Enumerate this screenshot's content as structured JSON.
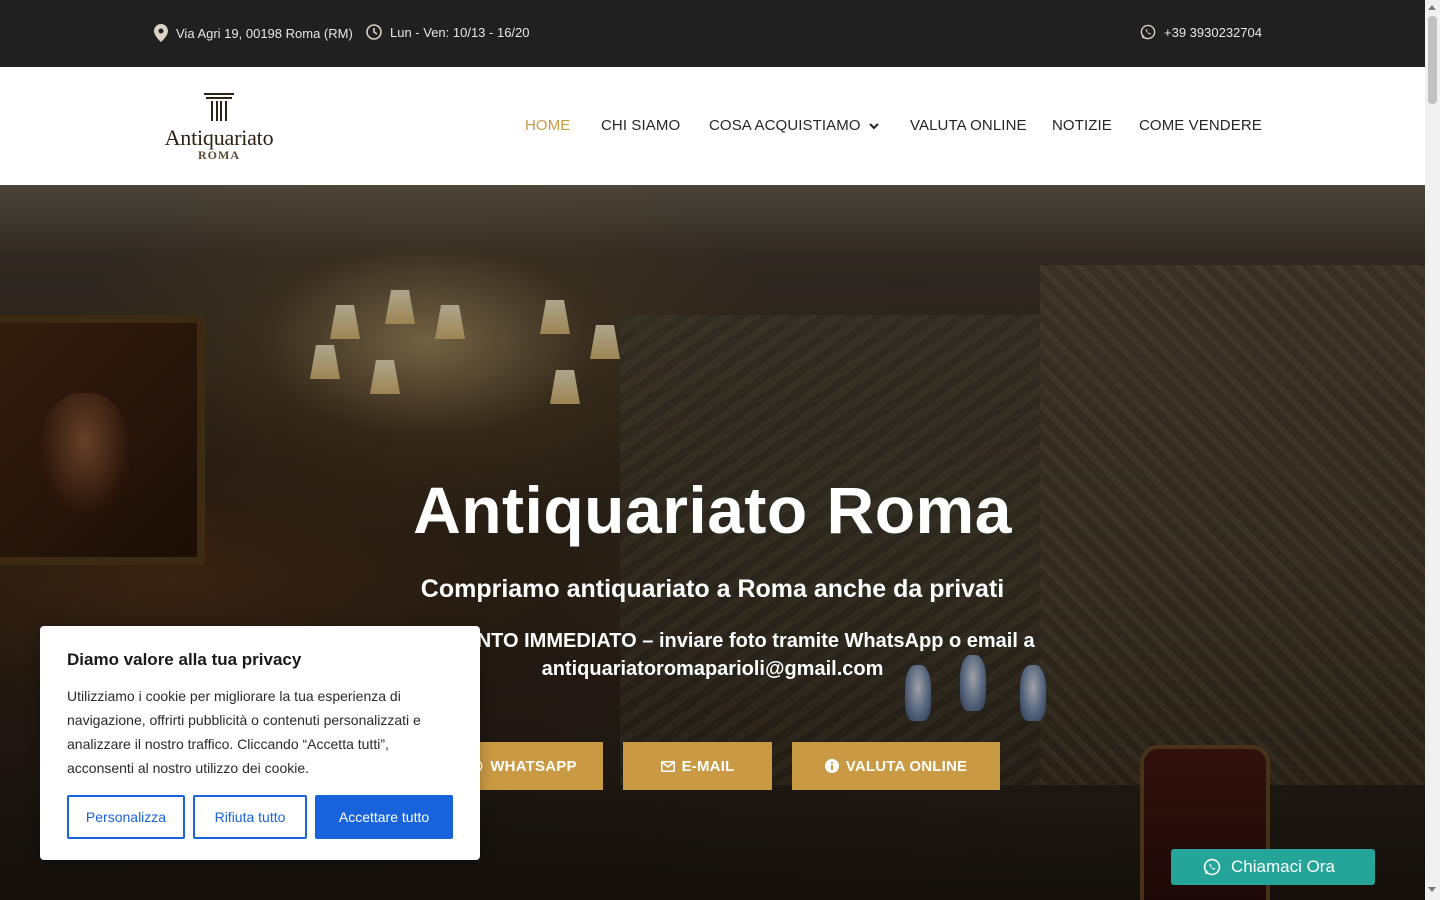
{
  "topbar": {
    "address": "Via Agri 19, 00198 Roma (RM)",
    "hours": "Lun - Ven: 10/13 - 16/20",
    "phone": "+39 3930232704"
  },
  "logo": {
    "name": "Antiquariato",
    "sub": "ROMA"
  },
  "nav": {
    "items": [
      {
        "label": "HOME",
        "active": true
      },
      {
        "label": "CHI SIAMO"
      },
      {
        "label": "COSA ACQUISTIAMO",
        "has_dropdown": true
      },
      {
        "label": "VALUTA ONLINE"
      },
      {
        "label": "NOTIZIE"
      },
      {
        "label": "COME VENDERE"
      }
    ]
  },
  "hero": {
    "title": "Antiquariato Roma",
    "subtitle": "Compriamo antiquariato a Roma anche da privati",
    "lead_line1": "PAGAMENTO IMMEDIATO – inviare foto tramite WhatsApp o email a",
    "lead_line2": "antiquariatoromaparioli@gmail.com",
    "buttons": {
      "whatsapp": "WHATSAPP",
      "email": "E-MAIL",
      "valuta": "VALUTA ONLINE"
    }
  },
  "cookie": {
    "title": "Diamo valore alla tua privacy",
    "text": "Utilizziamo i cookie per migliorare la tua esperienza di navigazione, offrirti pubblicità o contenuti personalizzati e analizzare il nostro traffico. Cliccando “Accetta tutti”, acconsenti al nostro utilizzo dei cookie.",
    "customize": "Personalizza",
    "reject": "Rifiuta tutto",
    "accept": "Accettare tutto"
  },
  "floating": {
    "call": "Chiamaci Ora"
  },
  "colors": {
    "accent": "#c99a43",
    "nav_active": "#c49a45",
    "cookie_blue": "#1863dc",
    "whatsapp_teal": "#25a59a",
    "topbar_bg": "#202020"
  }
}
